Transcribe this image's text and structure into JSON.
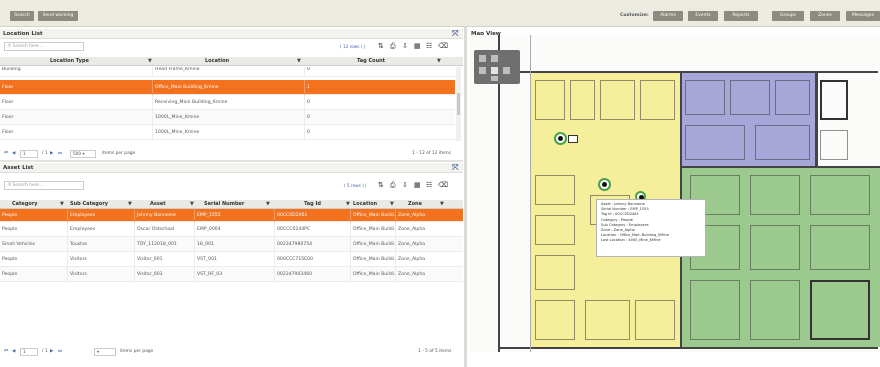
{
  "toolbar": {
    "search_label": "Search",
    "send_warning_label": "Send warning",
    "customize_label": "Customize:",
    "tabs": [
      "Alarms",
      "Events",
      "Reports",
      "Groups",
      "Zones",
      "Messages"
    ]
  },
  "location_list": {
    "title": "Location List",
    "search_placeholder": "Search here ...",
    "row_count": "( 12 rows ) |",
    "columns": [
      "Location Type",
      "Location",
      "Tag Count"
    ],
    "rows": [
      [
        "Building",
        "Head Frame_Kmine",
        "0"
      ],
      [
        "Floor",
        "Office_Main Building_Kmine",
        "1"
      ],
      [
        "Floor",
        "Receiving_Main Building_Kmine",
        "0"
      ],
      [
        "Floor",
        "1000L_Mine_Kmine",
        "0"
      ],
      [
        "Floor",
        "1000L_Mine_Kmine",
        "0"
      ]
    ],
    "pager": {
      "page": "1",
      "of": "/ 1",
      "page_size": "500",
      "items_per_page": "items per page",
      "summary": "1 - 12 of 12 items"
    }
  },
  "asset_list": {
    "title": "Asset List",
    "search_placeholder": "Search here ...",
    "row_count": "( 5 rows ) |",
    "columns": [
      "Category",
      "Sub Category",
      "Asset",
      "Serial Number",
      "Tag Id",
      "Location",
      "Zone"
    ],
    "rows": [
      [
        "People",
        "Employees",
        "Johnny Bonnome",
        "EMP_1555",
        "00CC0D2461",
        "Office_Main Buildi..",
        "Zone_Alpha"
      ],
      [
        "People",
        "Employees",
        "Oscar Oldschool",
        "EMP_0004",
        "00CCC0244PC",
        "Office_Main Buildi..",
        "Zone_Alpha"
      ],
      [
        "Small Vehicles",
        "Toustas",
        "TOY_112018_001",
        "18_001",
        "002347980754",
        "Office_Main Buildi..",
        "Zone_Alpha"
      ],
      [
        "People",
        "Visitors",
        "Visitor_001",
        "VST_001",
        "000CCC715E00",
        "Office_Main Buildi..",
        "Zone_Alpha"
      ],
      [
        "People",
        "Visitors",
        "Visitor_003",
        "VST_RF_03",
        "002347903460",
        "Office_Main Buildi..",
        "Zone_Alpha"
      ]
    ],
    "pager": {
      "page": "1",
      "of": "/ 1",
      "page_size": "",
      "items_per_page": "items per page",
      "summary": "1 - 5 of 5 items"
    }
  },
  "map": {
    "title": "Map View",
    "tooltip": [
      "Asset : Johnny Bonnome",
      "Serial Number : EMP_1555",
      "Tag Id : 00CC0D2461",
      "Category : People",
      "Sub Category : Employees",
      "Zone : Zone_Alpha",
      "Location : Office_Main Building_KMine",
      "Last Location : 4000_Mine_KMine"
    ]
  },
  "colors": {
    "selected_row": "#f4711e",
    "zone_yellow": "#f5ee9a",
    "zone_purple": "#a7a6d8",
    "zone_green": "#9cca8e",
    "topbar_button": "#8d8a7f"
  }
}
